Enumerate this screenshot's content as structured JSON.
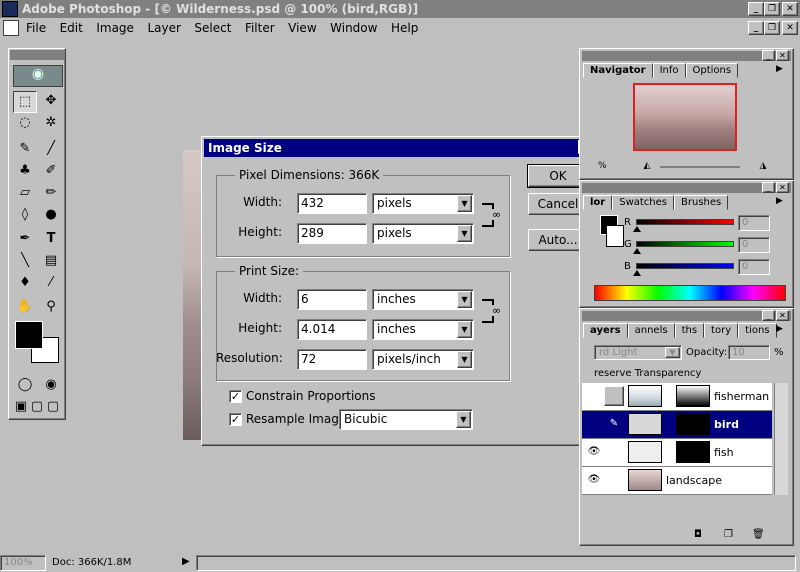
{
  "app": {
    "title": "Adobe Photoshop - [© Wilderness.psd @ 100% (bird,RGB)]"
  },
  "menu": [
    "File",
    "Edit",
    "Image",
    "Layer",
    "Select",
    "Filter",
    "View",
    "Window",
    "Help"
  ],
  "window_buttons": {
    "min": "_",
    "restore": "❐",
    "close": "✕"
  },
  "dialog": {
    "title": "Image Size",
    "pixel_group": {
      "label": "Pixel Dimensions:  366K",
      "width_label": "Width:",
      "width_value": "432",
      "width_unit": "pixels",
      "height_label": "Height:",
      "height_value": "289",
      "height_unit": "pixels"
    },
    "print_group": {
      "label": "Print Size:",
      "width_label": "Width:",
      "width_value": "6",
      "width_unit": "inches",
      "height_label": "Height:",
      "height_value": "4.014",
      "height_unit": "inches",
      "res_label": "Resolution:",
      "res_value": "72",
      "res_unit": "pixels/inch"
    },
    "constrain": {
      "label": "Constrain Proportions",
      "checked": true
    },
    "resample": {
      "label": "Resample Image:",
      "checked": true,
      "method": "Bicubic"
    },
    "buttons": {
      "ok": "OK",
      "cancel": "Cancel",
      "auto": "Auto..."
    }
  },
  "navigator": {
    "tabs": [
      "Navigator",
      "Info",
      "Options"
    ],
    "zoom": "%"
  },
  "color": {
    "tabs": [
      "lor",
      "Swatches",
      "Brushes"
    ],
    "r_label": "R",
    "g_label": "G",
    "b_label": "B",
    "r": "0",
    "g": "0",
    "b": "0"
  },
  "layers": {
    "tabs": [
      "ayers",
      "annels",
      "ths",
      "tory",
      "tions"
    ],
    "mode": "rd Light",
    "opacity_label": "Opacity:",
    "opacity": "10",
    "pct": "%",
    "preserve": "reserve Transparency",
    "rows": [
      {
        "name": "fisherman"
      },
      {
        "name": "bird"
      },
      {
        "name": "fish"
      },
      {
        "name": "landscape"
      }
    ]
  },
  "status": {
    "zoom": "100%",
    "doc": "Doc: 366K/1.8M"
  },
  "colors": {
    "title_active": "#000080",
    "face": "#c0c0c0",
    "desktop": "#bfbfbf"
  }
}
